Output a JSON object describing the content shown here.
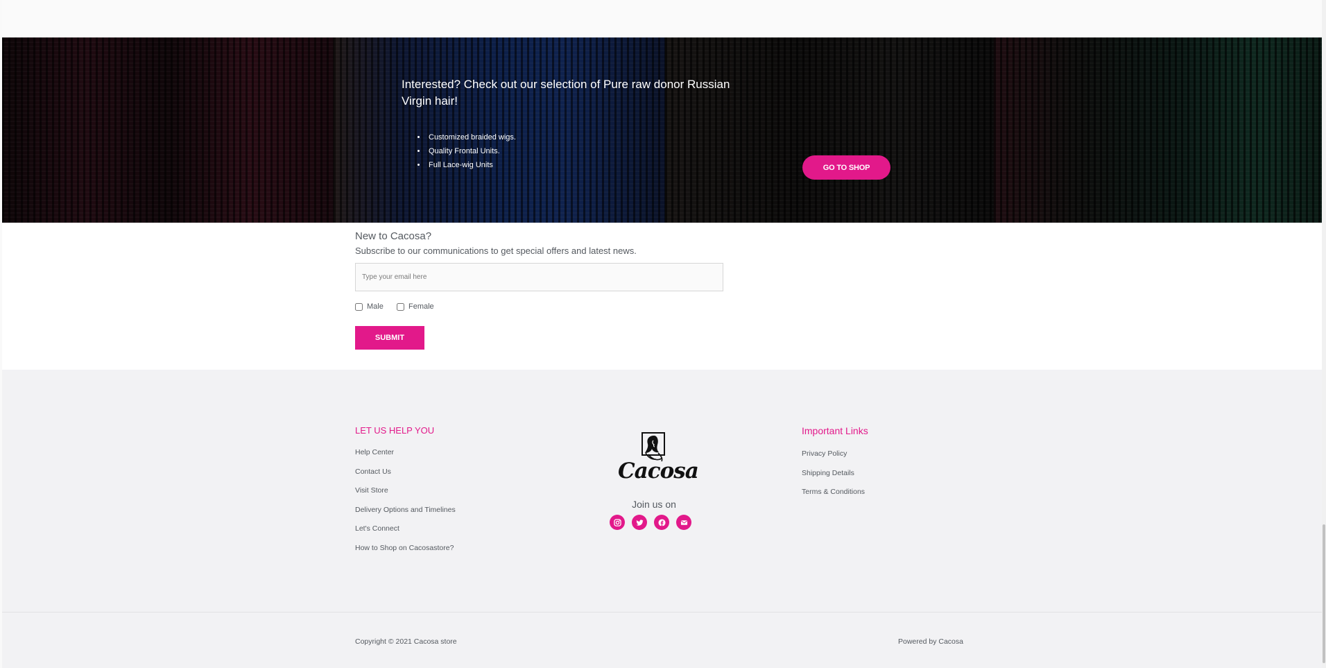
{
  "hero": {
    "title": "Interested? Check out our selection of Pure raw donor Russian Virgin hair!",
    "items": [
      "Customized braided wigs.",
      "Quality Frontal Units.",
      "Full Lace-wig Units"
    ],
    "shop_button": "GO TO SHOP"
  },
  "subscribe": {
    "title": "New to Cacosa?",
    "text": "Subscribe to our communications to get special offers and latest news.",
    "email_placeholder": "Type your email here",
    "options": [
      "Male",
      "Female"
    ],
    "submit": "SUBMIT"
  },
  "footer": {
    "help_heading": "LET US HELP YOU",
    "help_links": [
      "Help Center",
      "Contact Us",
      "Visit Store",
      "Delivery Options and Timelines",
      "Let's Connect",
      "How to Shop on Cacosastore?"
    ],
    "logo_text": "Cacosa",
    "join_text": "Join us on",
    "socials": [
      "instagram-icon",
      "twitter-icon",
      "facebook-icon",
      "envelope-icon"
    ],
    "links_heading": "Important Links",
    "important_links": [
      "Privacy Policy",
      "Shipping Details",
      "Terms & Conditions"
    ],
    "copyright": "Copyright © 2021 Cacosa store",
    "powered": "Powered by Cacosa"
  },
  "colors": {
    "accent": "#e2198a",
    "footer_bg": "#f2f2f4",
    "text": "#54595f"
  }
}
